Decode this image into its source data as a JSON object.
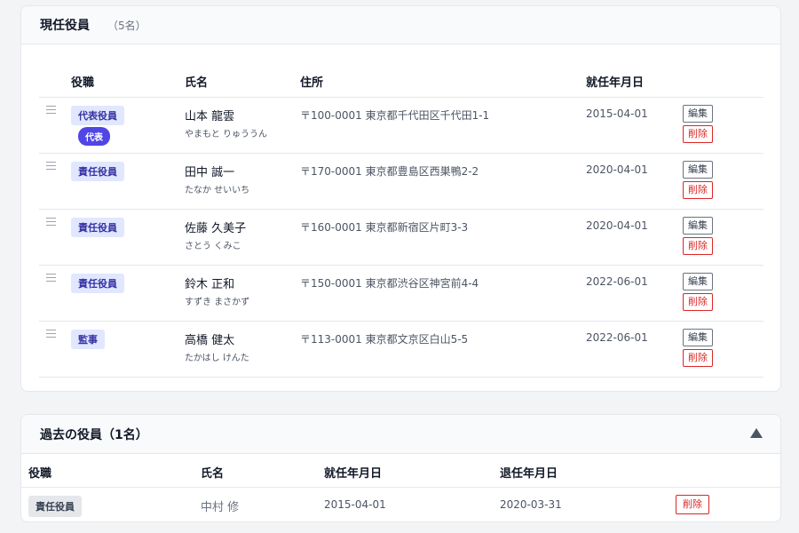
{
  "current": {
    "title": "現任役員",
    "count": "（5名）",
    "headers": {
      "role": "役職",
      "name": "氏名",
      "address": "住所",
      "date": "就任年月日"
    },
    "rows": [
      {
        "role": "代表役員",
        "rep_badge": "代表",
        "name": "山本 龍雲",
        "kana": "やまもと りゅううん",
        "address": "〒100-0001 東京都千代田区千代田1-1",
        "date": "2015-04-01",
        "edit": "編集",
        "delete": "削除"
      },
      {
        "role": "責任役員",
        "name": "田中 誠一",
        "kana": "たなか せいいち",
        "address": "〒170-0001 東京都豊島区西巣鴨2-2",
        "date": "2020-04-01",
        "edit": "編集",
        "delete": "削除"
      },
      {
        "role": "責任役員",
        "name": "佐藤 久美子",
        "kana": "さとう くみこ",
        "address": "〒160-0001 東京都新宿区片町3-3",
        "date": "2020-04-01",
        "edit": "編集",
        "delete": "削除"
      },
      {
        "role": "責任役員",
        "name": "鈴木 正和",
        "kana": "すずき まさかず",
        "address": "〒150-0001 東京都渋谷区神宮前4-4",
        "date": "2022-06-01",
        "edit": "編集",
        "delete": "削除"
      },
      {
        "role": "監事",
        "name": "高橋 健太",
        "kana": "たかはし けんた",
        "address": "〒113-0001 東京都文京区白山5-5",
        "date": "2022-06-01",
        "edit": "編集",
        "delete": "削除"
      }
    ]
  },
  "past": {
    "title": "過去の役員（1名）",
    "toggle_icon": "triangle-up-icon",
    "headers": {
      "role": "役職",
      "name": "氏名",
      "start": "就任年月日",
      "end": "退任年月日"
    },
    "rows": [
      {
        "role": "責任役員",
        "name": "中村 修",
        "start": "2015-04-01",
        "end": "2020-03-31",
        "delete": "削除"
      }
    ]
  },
  "colors": {
    "role_badge_bg": "#e0e7ff",
    "rep_badge_bg": "#4f46e5",
    "delete_red": "#dc2626"
  }
}
